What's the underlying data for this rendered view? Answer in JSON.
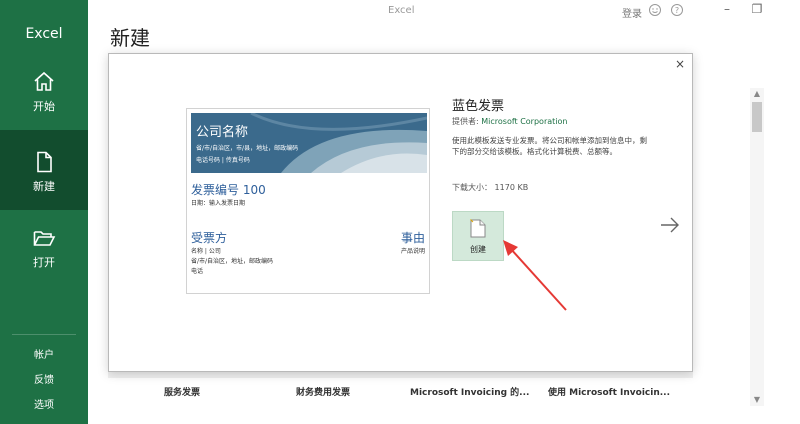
{
  "app": {
    "name": "Excel",
    "window_title": "Excel",
    "signin": "登录"
  },
  "titlebar": {
    "icons": [
      "smiley-icon",
      "help-icon"
    ],
    "buttons": [
      "minimize-icon",
      "restore-icon"
    ]
  },
  "sidebar": {
    "items": [
      {
        "label": "开始",
        "icon": "home-icon"
      },
      {
        "label": "新建",
        "icon": "new-document-icon",
        "selected": true
      },
      {
        "label": "打开",
        "icon": "open-folder-icon"
      }
    ],
    "bottom_links": [
      "帐户",
      "反馈",
      "选项"
    ],
    "colors": {
      "background": "#1e7145",
      "selected": "#124d2e"
    }
  },
  "page": {
    "title": "新建"
  },
  "gallery": {
    "captions": [
      "服务发票",
      "财务费用发票",
      "Microsoft Invoicing 的...",
      "使用 Microsoft Invoicin..."
    ]
  },
  "template": {
    "title": "蓝色发票",
    "provider_label": "提供者:",
    "provider_name": "Microsoft Corporation",
    "description": "使用此模板发送专业发票。将公司和帐单添加到信息中，剩下的部分交给该模板。格式化计算税费、总额等。",
    "download_size_label": "下载大小：",
    "download_size_value": "1170 KB",
    "create_label": "创建",
    "preview": {
      "company": "公司名称",
      "address": "省/市/自治区，市/县，地址，邮政编码",
      "phone": "电话号码 | 传真号码",
      "invoice_no": "发票编号 100",
      "date": "日期：输入发票日期",
      "bill_to": "受票方",
      "subject": "事由",
      "name_company": "名称 | 公司",
      "address2": "省/市/自治区，地址，邮政编码",
      "phone2": "电话",
      "product_desc": "产品说明"
    }
  },
  "modal": {
    "close": "×"
  },
  "icons": {
    "next": "arrow-right-icon",
    "close": "close-icon"
  }
}
